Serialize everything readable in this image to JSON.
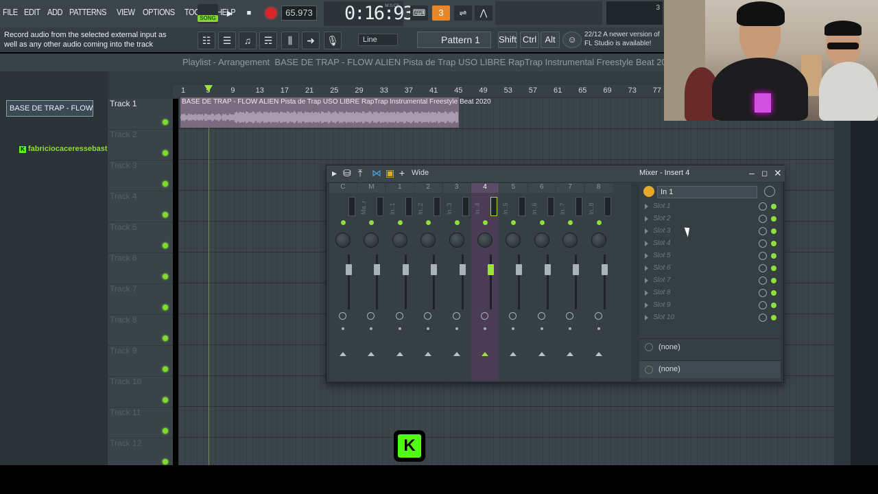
{
  "menu": [
    "FILE",
    "EDIT",
    "ADD",
    "PATTERNS",
    "VIEW",
    "OPTIONS",
    "TOOLS",
    "HELP"
  ],
  "transport": {
    "mode_label": "SONG",
    "tempo": "65.973",
    "time": "0:16:93",
    "time_units": "M:S:CS",
    "cpu_value": "3"
  },
  "hint": "Record audio from the selected external input as well as any other audio coming into the track",
  "snap": "Line",
  "pattern": "Pattern 1",
  "modifiers": [
    "Shift",
    "Ctrl",
    "Alt"
  ],
  "news": {
    "date": "22/12",
    "text": "A newer version of FL Studio is available!"
  },
  "playlist": {
    "title": "Playlist - Arrangement",
    "breadcrumb": "BASE DE TRAP - FLOW ALIEN  Pista de Trap USO LIBRE  RapTrap Instrumental Freestyle Beat 2020",
    "selected_clip": "BASE DE TRAP - FLOW...",
    "clip_label": "BASE DE TRAP - FLOW ALIEN  Pista de Trap USO LIBRE  RapTrap Instrumental Freestyle Beat 2020",
    "ruler": [
      "1",
      "5",
      "9",
      "13",
      "17",
      "21",
      "25",
      "29",
      "33",
      "37",
      "41",
      "45",
      "49",
      "53",
      "57",
      "61",
      "65",
      "69",
      "73",
      "77"
    ],
    "tracks": [
      "Track 1",
      "Track 2",
      "Track 3",
      "Track 4",
      "Track 5",
      "Track 6",
      "Track 7",
      "Track 8",
      "Track 9",
      "Track 10",
      "Track 11",
      "Track 12"
    ]
  },
  "chat": {
    "user": "fabriciocaceressebastian :"
  },
  "mixer": {
    "title": "Mixer - Insert 4",
    "stereo_mode": "Wide",
    "strips": [
      {
        "num": "C",
        "name": ""
      },
      {
        "num": "M",
        "name": "Ma..r"
      },
      {
        "num": "1",
        "name": "In..1"
      },
      {
        "num": "2",
        "name": "In..2"
      },
      {
        "num": "3",
        "name": "In..3"
      },
      {
        "num": "4",
        "name": "In..4"
      },
      {
        "num": "5",
        "name": "In..5"
      },
      {
        "num": "6",
        "name": "In..6"
      },
      {
        "num": "7",
        "name": "In..7"
      },
      {
        "num": "8",
        "name": "In..8"
      }
    ],
    "selected_strip": "4",
    "input": "In 1",
    "slots": [
      "Slot 1",
      "Slot 2",
      "Slot 3",
      "Slot 4",
      "Slot 5",
      "Slot 6",
      "Slot 7",
      "Slot 8",
      "Slot 9",
      "Slot 10"
    ],
    "eq_input": "(none)",
    "output": "(none)"
  },
  "colors": {
    "accent_green": "#8fe03b",
    "selected_strip": "#4a3c55",
    "kick_green": "#53fc18"
  }
}
